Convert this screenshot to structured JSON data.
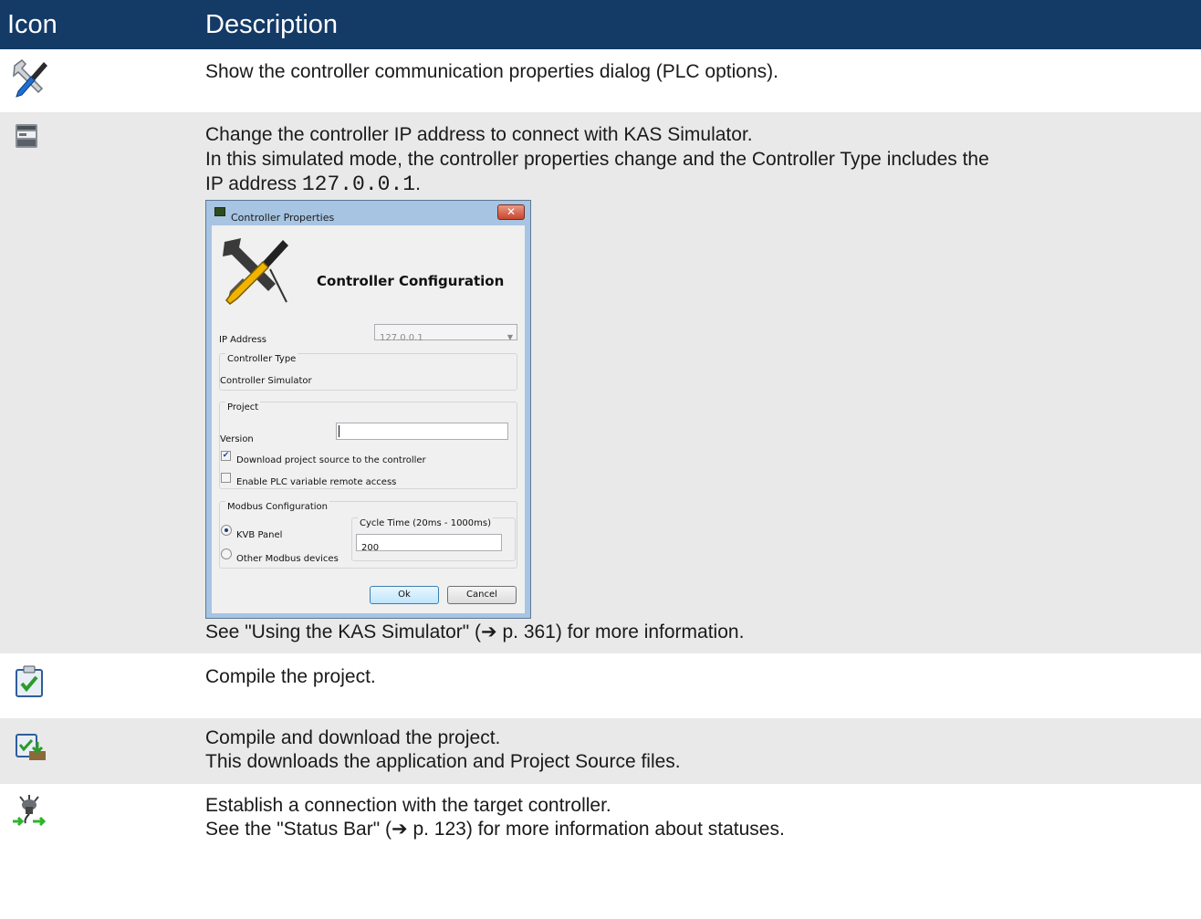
{
  "table": {
    "header": {
      "icon": "Icon",
      "description": "Description"
    },
    "rows": [
      {
        "icon": "wrench-screwdriver-icon",
        "lines": [
          "Show the controller communication properties dialog (PLC options)."
        ]
      },
      {
        "icon": "simulator-icon",
        "lines": [
          "Change the controller IP address to connect with KAS Simulator.",
          "In this simulated mode, the controller properties change and the Controller Type includes the",
          "IP address "
        ],
        "ip_code": "127.0.0.1",
        "ip_suffix": ".",
        "after": "See \"Using the KAS Simulator\" (➔ p. 361) for more information."
      },
      {
        "icon": "compile-icon",
        "lines": [
          "Compile the project."
        ]
      },
      {
        "icon": "compile-download-icon",
        "lines": [
          "Compile and download the project.",
          "This downloads the application and Project Source files."
        ]
      },
      {
        "icon": "connect-icon",
        "lines": [
          "Establish a connection with the target controller.",
          "See the \"Status Bar\" (➔ p. 123) for more information about statuses."
        ]
      }
    ]
  },
  "dialog": {
    "title": "Controller Properties",
    "close": "✕",
    "heading": "Controller Configuration",
    "ip_label": "IP Address",
    "ip_value": "127.0.0.1",
    "controller_type_label": "Controller Type",
    "controller_type_value": "Controller Simulator",
    "project_label": "Project",
    "version_label": "Version",
    "version_value": "",
    "download_source_label": "Download project source to the controller",
    "download_source_checked": true,
    "remote_access_label": "Enable PLC variable remote access",
    "remote_access_checked": false,
    "modbus_label": "Modbus Configuration",
    "kvb_label": "KVB Panel",
    "other_modbus_label": "Other Modbus devices",
    "cycle_time_label": "Cycle Time (20ms - 1000ms)",
    "cycle_time_value": "200",
    "ok_label": "Ok",
    "cancel_label": "Cancel"
  },
  "colors": {
    "header_bg": "#143a66",
    "alt_row_bg": "#e9e9e9"
  }
}
